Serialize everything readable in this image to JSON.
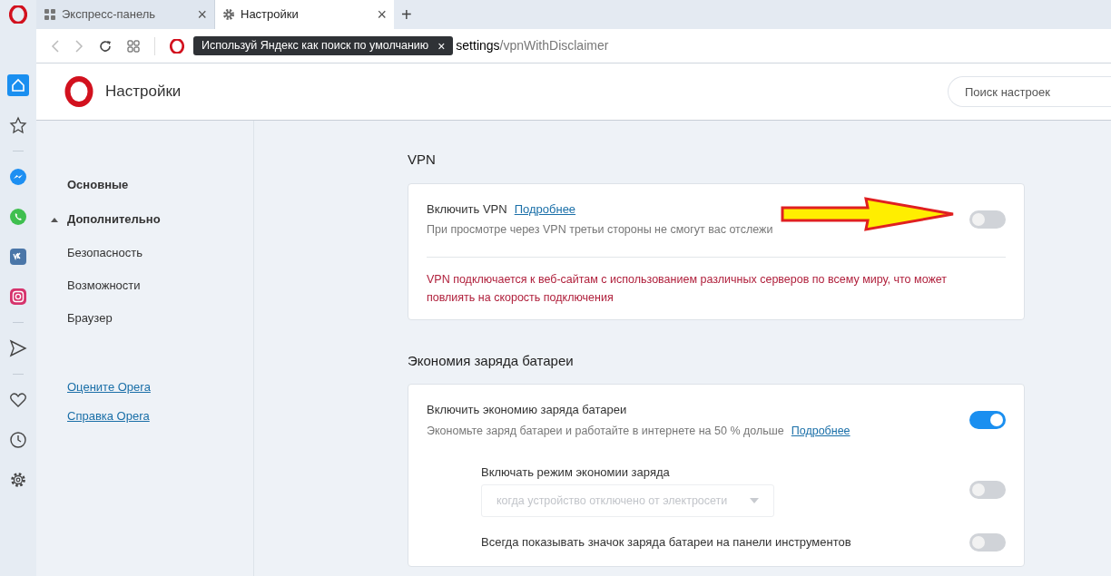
{
  "tabs": [
    {
      "kind": "grid",
      "label": "Экспресс-панель",
      "close": "×",
      "selected": false
    },
    {
      "kind": "gear",
      "label": "Настройки",
      "close": "×",
      "selected": true
    }
  ],
  "new_tab": "+",
  "address_bar": {
    "tooltip": "Используй Яндекс как поиск по умолчанию",
    "tooltip_close": "×",
    "url_host": "settings",
    "url_path": "/vpnWithDisclaimer"
  },
  "rail": [
    {
      "kind": "home",
      "selected": true
    },
    {
      "kind": "star",
      "selected": false
    },
    {
      "kind": "divider"
    },
    {
      "kind": "messenger",
      "selected": false
    },
    {
      "kind": "whatsapp",
      "selected": false
    },
    {
      "kind": "vk",
      "selected": false
    },
    {
      "kind": "instagram",
      "selected": false
    },
    {
      "kind": "divider"
    },
    {
      "kind": "send",
      "selected": false
    },
    {
      "kind": "divider"
    },
    {
      "kind": "heart",
      "selected": false
    },
    {
      "kind": "clock",
      "selected": false
    },
    {
      "kind": "gear",
      "selected": false
    }
  ],
  "header": {
    "title": "Настройки",
    "search": {
      "placeholder": "Поиск настроек"
    }
  },
  "nav": [
    {
      "kind": "section",
      "label": "Основные"
    },
    {
      "kind": "group",
      "label": "Дополнительно",
      "expanded": true
    },
    {
      "kind": "item",
      "label": "Безопасность"
    },
    {
      "kind": "item",
      "label": "Возможности"
    },
    {
      "kind": "item",
      "label": "Браузер"
    },
    {
      "kind": "link",
      "label": "Оцените Opera"
    },
    {
      "kind": "link",
      "label": "Справка Opera"
    }
  ],
  "sections": [
    {
      "title": "VPN",
      "rows": [
        {
          "kind": "toggle",
          "label": "Включить VPN",
          "link": "Подробнее",
          "description": "При просмотре через VPN третьи стороны не смогут вас отслежи",
          "on": false,
          "arrow": true
        },
        {
          "kind": "notice",
          "text": "VPN подключается к веб-сайтам с использованием различных серверов по всему миру, что может повлиять на скорость подключения"
        }
      ]
    },
    {
      "title": "Экономия заряда батареи",
      "rows": [
        {
          "kind": "toggle",
          "label": "Включить экономию заряда батареи",
          "description": "Экономьте заряд батареи и работайте в интернете на 50 % дольше",
          "link": "Подробнее",
          "on": true
        },
        {
          "kind": "select",
          "label": "Включать режим экономии заряда",
          "value": "когда устройство отключено от электросети",
          "on": false
        },
        {
          "kind": "subtoggle",
          "label": "Всегда показывать значок заряда батареи на панели инструментов",
          "on": false
        }
      ]
    }
  ]
}
